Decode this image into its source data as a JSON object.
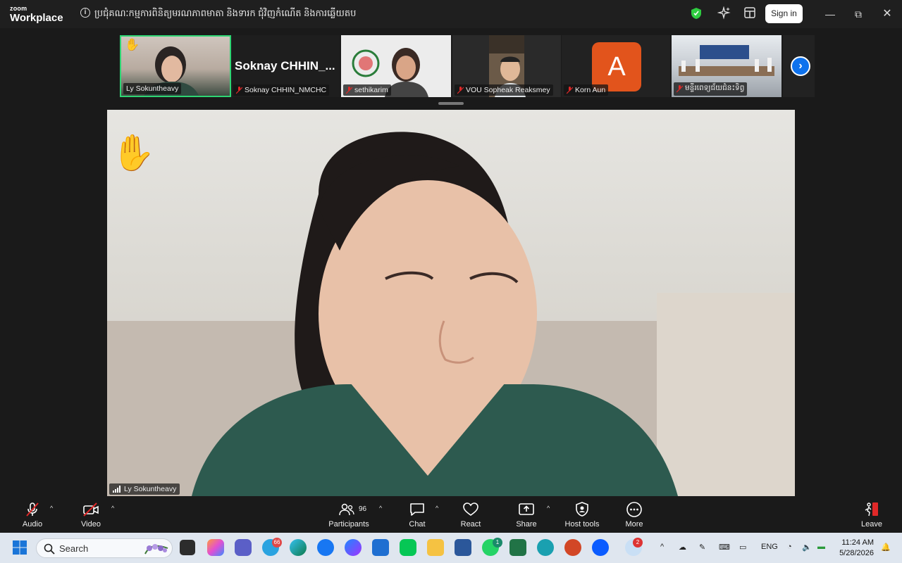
{
  "app": {
    "logo_small": "zoom",
    "logo_big": "Workplace"
  },
  "meeting": {
    "title": "ប្រជុំគណៈកម្មការពិនិត្យមរណភាពមាតា និងទារក ជុំវិញកំណើត និងការឆ្លើយតប"
  },
  "titlebar": {
    "signin_label": "Sign in"
  },
  "gallery": [
    {
      "name": "Ly Sokuntheavy",
      "hand_raised": true,
      "active": true
    },
    {
      "name": "Soknay CHHIN_NMCHC",
      "display": "Soknay  CHHIN_...",
      "muted": true
    },
    {
      "name": "sethikarim",
      "muted": true
    },
    {
      "name": "VOU Sopheak Reaksmey",
      "muted": true
    },
    {
      "name": "Korn Aun",
      "avatar_letter": "A",
      "muted": true
    },
    {
      "name": "មន្ទីរពេទ្យជ័យជំនះទិព្វ",
      "muted": true
    }
  ],
  "main_video": {
    "speaker_name": "Ly Sokuntheavy",
    "hand_raised": true
  },
  "toolbar": {
    "audio": "Audio",
    "video": "Video",
    "participants": "Participants",
    "participants_count": "96",
    "chat": "Chat",
    "react": "React",
    "share": "Share",
    "host_tools": "Host tools",
    "more": "More",
    "leave": "Leave"
  },
  "taskbar": {
    "search_label": "Search",
    "telegram_badge": "66",
    "whatsapp_badge": "1",
    "weather_badge": "2",
    "language": "ENG",
    "time": "11:24 AM",
    "date": "5/28/2026"
  },
  "colors": {
    "accent": "#0e72ed",
    "active_border": "#2ed573",
    "leave": "#e02828"
  }
}
